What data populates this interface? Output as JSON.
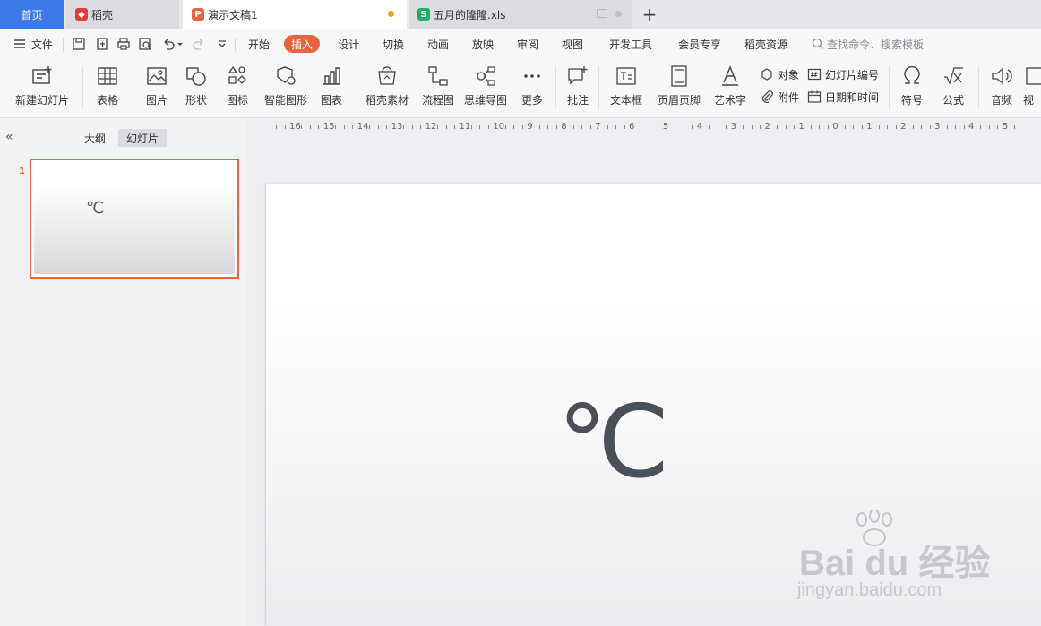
{
  "tabs": {
    "home": "首页",
    "daoke": "稻壳",
    "doc": "演示文稿1",
    "xls": "五月的隆隆.xls"
  },
  "menu": {
    "file": "文件",
    "items": [
      "开始",
      "插入",
      "设计",
      "切换",
      "动画",
      "放映",
      "审阅",
      "视图",
      "开发工具",
      "会员专享",
      "稻壳资源"
    ],
    "active": "插入",
    "search_placeholder": "查找命令、搜索模板"
  },
  "ribbon": {
    "new_slide": "新建幻灯片",
    "table": "表格",
    "picture": "图片",
    "shape": "形状",
    "icon": "图标",
    "smart_shape": "智能图形",
    "chart": "图表",
    "daoke_material": "稻壳素材",
    "flowchart": "流程图",
    "mindmap": "思维导图",
    "more": "更多",
    "comment": "批注",
    "textbox": "文本框",
    "header_footer": "页眉页脚",
    "wordart": "艺术字",
    "object": "对象",
    "attachment": "附件",
    "slide_number": "幻灯片编号",
    "date_time": "日期和时间",
    "symbol": "符号",
    "formula": "公式",
    "audio": "音频",
    "video": "视"
  },
  "panel": {
    "outline": "大纲",
    "slides": "幻灯片",
    "slide_number": "1",
    "thumb_text": "℃"
  },
  "ruler": [
    "16",
    "15",
    "14",
    "13",
    "12",
    "11",
    "10",
    "9",
    "8",
    "7",
    "6",
    "5",
    "4",
    "3",
    "2",
    "1",
    "0",
    "1",
    "2",
    "3",
    "4",
    "5"
  ],
  "slide": {
    "text": "℃"
  },
  "watermark": {
    "big": "Bai du 经验",
    "small": "jingyan.baidu.com"
  }
}
